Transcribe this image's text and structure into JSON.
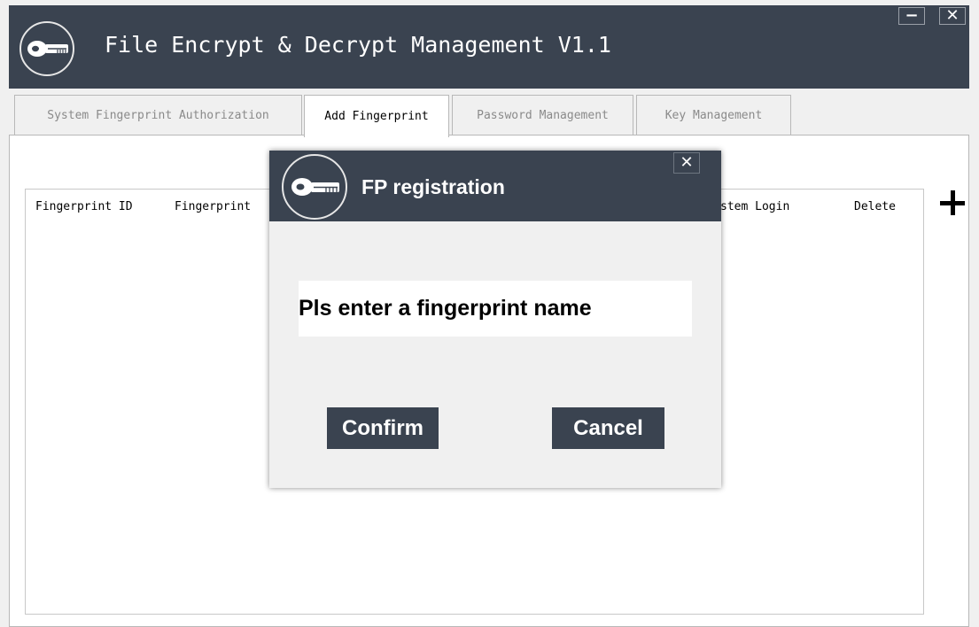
{
  "window": {
    "title": "File Encrypt & Decrypt Management V1.1",
    "minimize_glyph": "−",
    "close_glyph": "✕",
    "logo_icon": "key-icon"
  },
  "tabs": [
    {
      "label": "System Fingerprint Authorization",
      "active": false
    },
    {
      "label": "Add Fingerprint",
      "active": true
    },
    {
      "label": "Password Management",
      "active": false
    },
    {
      "label": "Key Management",
      "active": false
    }
  ],
  "table": {
    "columns": [
      "Fingerprint ID",
      "Fingerprint",
      "stem Login",
      "Delete"
    ],
    "rows": []
  },
  "add_button": {
    "icon": "plus-icon"
  },
  "dialog": {
    "title": "FP registration",
    "close_glyph": "✕",
    "logo_icon": "key-icon",
    "input_placeholder": "Pls enter a fingerprint name",
    "input_value": "",
    "confirm_label": "Confirm",
    "cancel_label": "Cancel"
  },
  "colors": {
    "titlebar": "#3a4350",
    "background": "#f0f0f0",
    "panel": "#ffffff",
    "button": "#3a4350",
    "inactive_tab_text": "#8a8a8a"
  }
}
